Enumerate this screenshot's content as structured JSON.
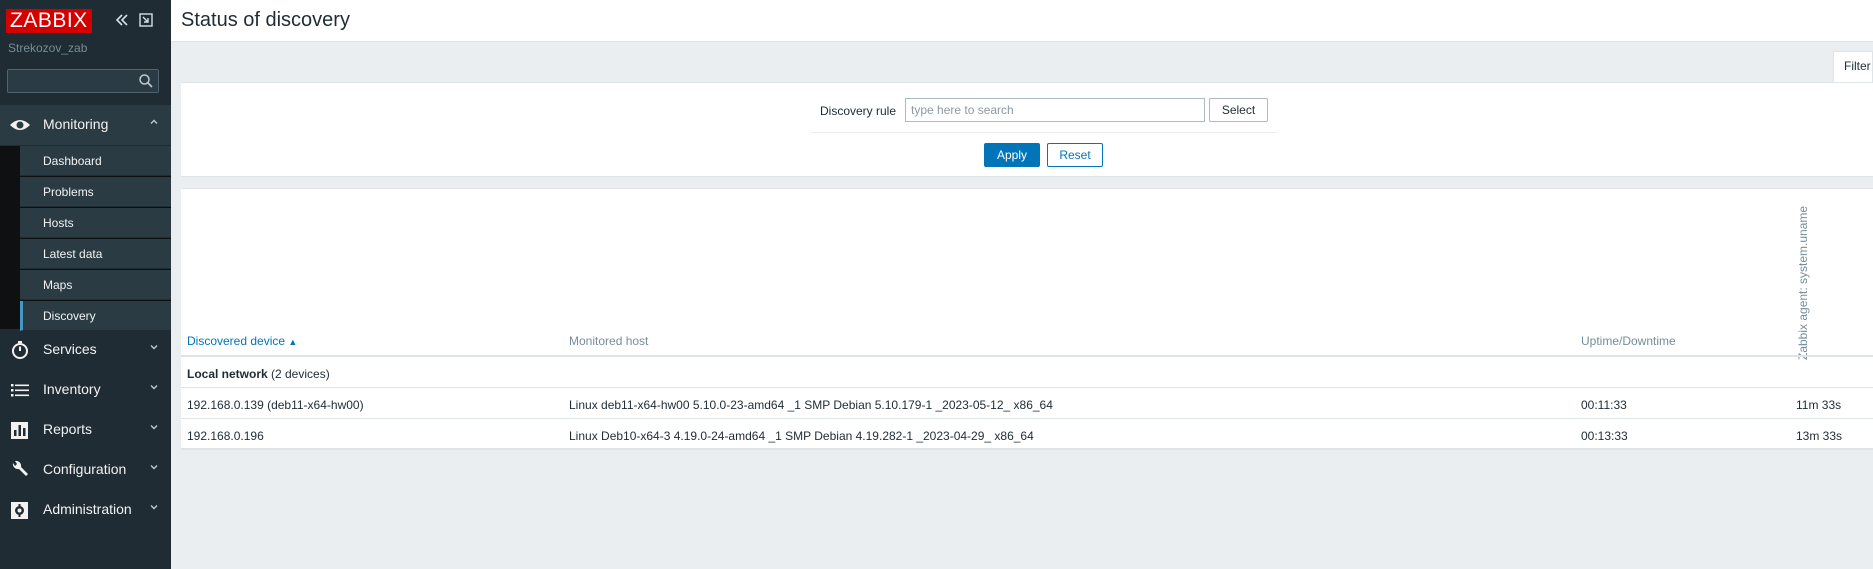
{
  "logo": "ZABBIX",
  "server_name": "Strekozov_zab",
  "icons": {
    "collapse": "double-chevron-left-icon",
    "kiosk": "kiosk-mode-icon",
    "search": "search-icon"
  },
  "colors": {
    "accent": "#0275b8",
    "sidebar_bg": "#1f2c33",
    "logo_bg": "#d40000"
  },
  "sidebar": {
    "search_value": "",
    "menu": [
      {
        "label": "Monitoring",
        "icon": "eye-icon",
        "expanded": true
      },
      {
        "label": "Services",
        "icon": "stopwatch-icon",
        "expanded": false
      },
      {
        "label": "Inventory",
        "icon": "list-icon",
        "expanded": false
      },
      {
        "label": "Reports",
        "icon": "bar-chart-icon",
        "expanded": false
      },
      {
        "label": "Configuration",
        "icon": "wrench-icon",
        "expanded": false
      },
      {
        "label": "Administration",
        "icon": "gear-icon",
        "expanded": false
      }
    ],
    "monitoring_items": [
      "Dashboard",
      "Problems",
      "Hosts",
      "Latest data",
      "Maps",
      "Discovery"
    ],
    "active_item": "Discovery"
  },
  "page": {
    "title": "Status of discovery"
  },
  "filter": {
    "tab_label": "Filter",
    "discovery_rule_label": "Discovery rule",
    "discovery_rule_placeholder": "type here to search",
    "select_label": "Select",
    "apply_label": "Apply",
    "reset_label": "Reset"
  },
  "table": {
    "columns": {
      "discovered_device": "Discovered device",
      "sort_indicator": "▲",
      "monitored_host": "Monitored host",
      "uptime": "Uptime/Downtime",
      "check": "Zabbix agent: system.uname"
    },
    "group": {
      "name": "Local network",
      "count": "(2 devices)"
    },
    "rows": [
      {
        "device": "192.168.0.139 (deb11-x64-hw00)",
        "host": "Linux deb11-x64-hw00 5.10.0-23-amd64 _1 SMP Debian 5.10.179-1 _2023-05-12_ x86_64",
        "uptime": "00:11:33",
        "check": "11m 33s"
      },
      {
        "device": "192.168.0.196",
        "host": "Linux Deb10-x64-3 4.19.0-24-amd64 _1 SMP Debian 4.19.282-1 _2023-04-29_ x86_64",
        "uptime": "00:13:33",
        "check": "13m 33s"
      }
    ]
  }
}
